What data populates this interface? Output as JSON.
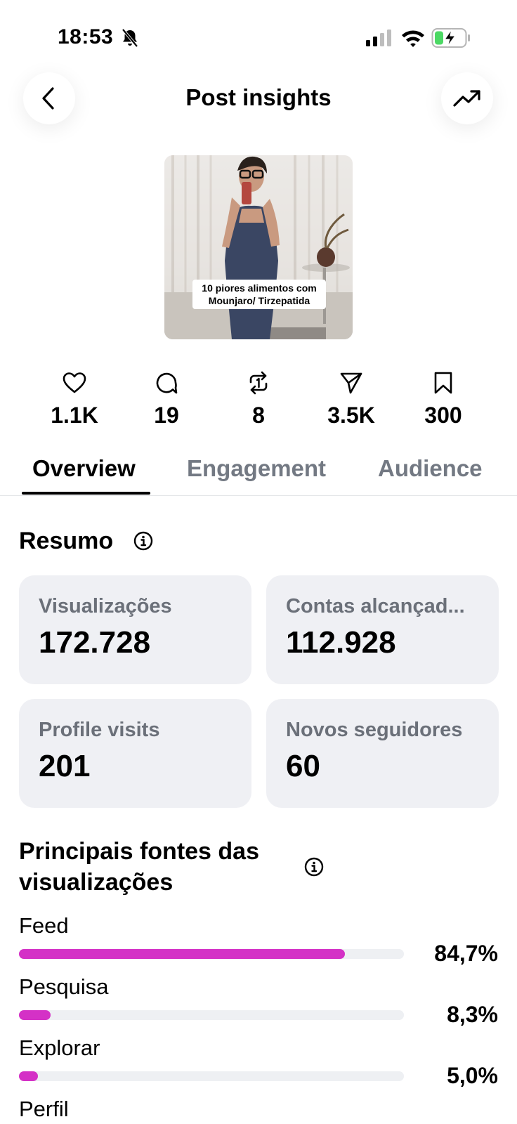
{
  "status_bar": {
    "time": "18:53",
    "icons": [
      "bell-slash-icon",
      "cellular-signal-icon",
      "wifi-icon",
      "battery-charging-icon"
    ]
  },
  "header": {
    "title": "Post insights",
    "back_icon": "chevron-left-icon",
    "trend_icon": "trending-up-icon"
  },
  "post": {
    "caption_line1": "10 piores alimentos com",
    "caption_line2": "Mounjaro/ Tirzepatida"
  },
  "stats": [
    {
      "icon": "heart-icon",
      "value": "1.1K"
    },
    {
      "icon": "comment-icon",
      "value": "19"
    },
    {
      "icon": "repost-icon",
      "value": "8"
    },
    {
      "icon": "share-icon",
      "value": "3.5K"
    },
    {
      "icon": "bookmark-icon",
      "value": "300"
    }
  ],
  "tabs": [
    {
      "label": "Overview",
      "active": true
    },
    {
      "label": "Engagement",
      "active": false
    },
    {
      "label": "Audience",
      "active": false
    }
  ],
  "summary": {
    "title": "Resumo",
    "cards": [
      {
        "label": "Visualizações",
        "value": "172.728"
      },
      {
        "label": "Contas alcançad...",
        "value": "112.928"
      },
      {
        "label": "Profile visits",
        "value": "201"
      },
      {
        "label": "Novos seguidores",
        "value": "60"
      }
    ]
  },
  "sources": {
    "title_line1": "Principais fontes das",
    "title_line2": "visualizações",
    "accent_color": "#d431c6",
    "items": [
      {
        "label": "Feed",
        "percent_text": "84,7%",
        "percent": 84.7
      },
      {
        "label": "Pesquisa",
        "percent_text": "8,3%",
        "percent": 8.3
      },
      {
        "label": "Explorar",
        "percent_text": "5,0%",
        "percent": 5.0
      },
      {
        "label": "Perfil"
      }
    ]
  }
}
